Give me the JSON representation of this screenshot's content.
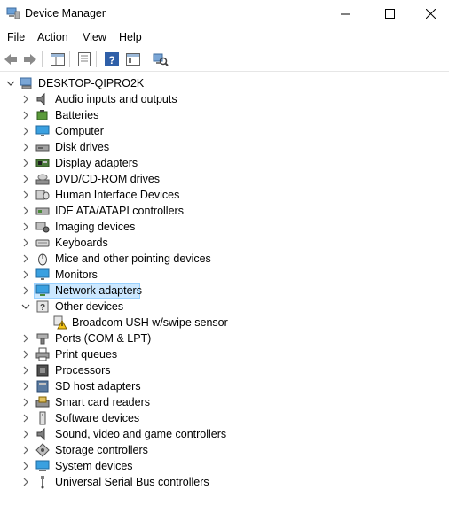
{
  "window": {
    "title": "Device Manager"
  },
  "menu": {
    "file": "File",
    "action": "Action",
    "view": "View",
    "help": "Help"
  },
  "tree": {
    "root": "DESKTOP-QIPRO2K",
    "categories": [
      "Audio inputs and outputs",
      "Batteries",
      "Computer",
      "Disk drives",
      "Display adapters",
      "DVD/CD-ROM drives",
      "Human Interface Devices",
      "IDE ATA/ATAPI controllers",
      "Imaging devices",
      "Keyboards",
      "Mice and other pointing devices",
      "Monitors",
      "Network adapters",
      "Other devices",
      "Ports (COM & LPT)",
      "Print queues",
      "Processors",
      "SD host adapters",
      "Smart card readers",
      "Software devices",
      "Sound, video and game controllers",
      "Storage controllers",
      "System devices",
      "Universal Serial Bus controllers"
    ],
    "other_devices_child": "Broadcom USH w/swipe sensor",
    "selected": "Network adapters",
    "expanded": "Other devices"
  },
  "colors": {
    "selection_bg": "#cce8ff",
    "selection_border": "#99d1ff"
  }
}
